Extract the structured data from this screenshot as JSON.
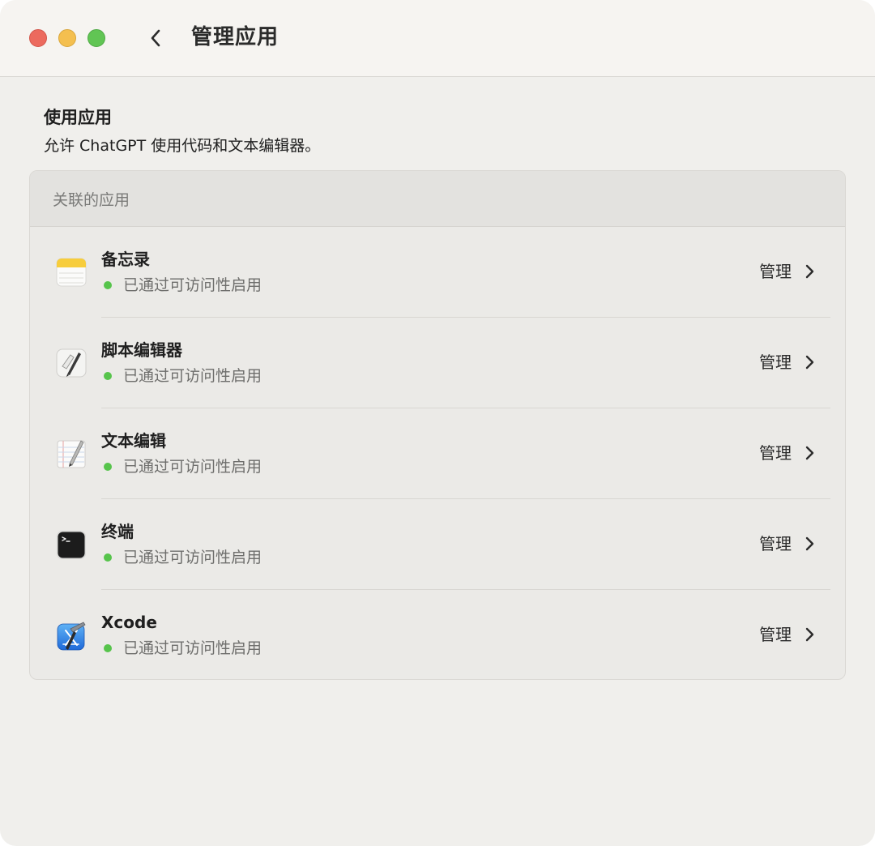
{
  "window": {
    "title": "管理应用",
    "traffic_lights": {
      "close": "#ec6a5e",
      "minimize": "#f4bf4f",
      "maximize": "#61c554"
    }
  },
  "section": {
    "heading": "使用应用",
    "description": "允许 ChatGPT 使用代码和文本编辑器。"
  },
  "panel": {
    "header": "关联的应用",
    "apps": [
      {
        "name": "备忘录",
        "icon": "notes-icon",
        "status": "已通过可访问性启用",
        "status_color": "#56c44b",
        "action": "管理"
      },
      {
        "name": "脚本编辑器",
        "icon": "script-editor-icon",
        "status": "已通过可访问性启用",
        "status_color": "#56c44b",
        "action": "管理"
      },
      {
        "name": "文本编辑",
        "icon": "textedit-icon",
        "status": "已通过可访问性启用",
        "status_color": "#56c44b",
        "action": "管理"
      },
      {
        "name": "终端",
        "icon": "terminal-icon",
        "status": "已通过可访问性启用",
        "status_color": "#56c44b",
        "action": "管理"
      },
      {
        "name": "Xcode",
        "icon": "xcode-icon",
        "status": "已通过可访问性启用",
        "status_color": "#56c44b",
        "action": "管理"
      }
    ]
  }
}
